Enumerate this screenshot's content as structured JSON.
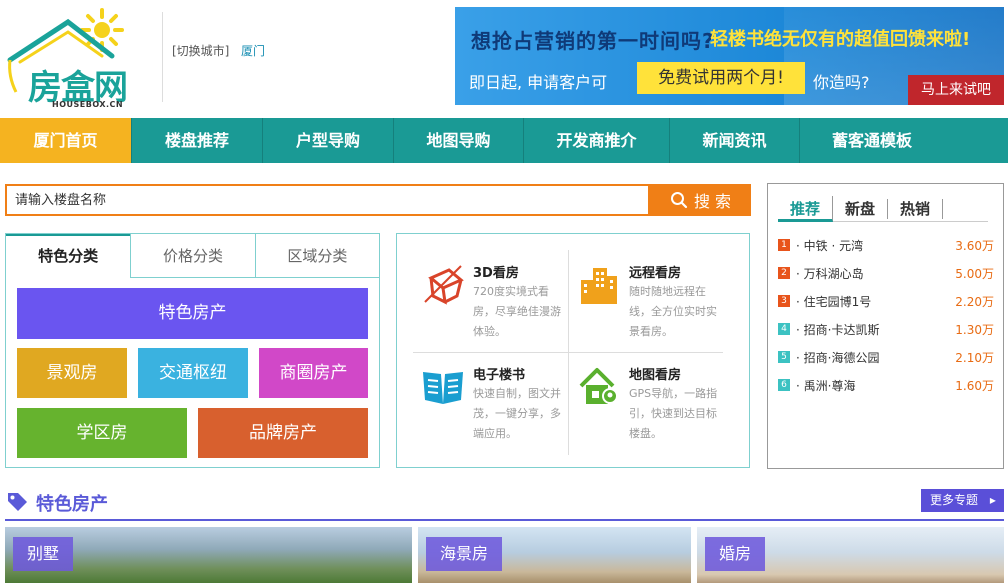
{
  "header": {
    "logo_text": "房盒网",
    "logo_sub": "HOUSEBOX.CN",
    "city_switch": "[切换城市]",
    "city": "厦门"
  },
  "banner": {
    "line1_a": "想抢占营销的第一时间吗?",
    "line1_b": "轻楼书绝无仅有的超值回馈来啦!",
    "line2_a": "即日起, 申请客户可",
    "highlight": "免费试用两个月!",
    "line2_b": "你造吗?",
    "cta": "马上来试吧"
  },
  "nav": {
    "items": [
      "厦门首页",
      "楼盘推荐",
      "户型导购",
      "地图导购",
      "开发商推介",
      "新闻资讯",
      "蓄客通模板"
    ]
  },
  "search": {
    "placeholder": "请输入楼盘名称",
    "button": "搜 索"
  },
  "categories": {
    "tabs": [
      "特色分类",
      "价格分类",
      "区域分类"
    ],
    "tiles": [
      {
        "label": "特色房产",
        "color": "#6a55f0"
      },
      {
        "label": "景观房",
        "color": "#e0a821"
      },
      {
        "label": "交通枢纽",
        "color": "#3ab2e0"
      },
      {
        "label": "商圈房产",
        "color": "#d148c8"
      },
      {
        "label": "学区房",
        "color": "#66b32e"
      },
      {
        "label": "品牌房产",
        "color": "#d8602e"
      }
    ]
  },
  "features": [
    {
      "title": "3D看房",
      "desc": "720度实境式看房，尽享绝佳漫游体验。",
      "icon": "cube-icon"
    },
    {
      "title": "远程看房",
      "desc": "随时随地远程在线，全方位实时实景看房。",
      "icon": "buildings-icon"
    },
    {
      "title": "电子楼书",
      "desc": "快速自制，图文并茂，一键分享，多端应用。",
      "icon": "book-icon"
    },
    {
      "title": "地图看房",
      "desc": "GPS导航，一路指引，快速到达目标楼盘。",
      "icon": "map-house-icon"
    }
  ],
  "ranking": {
    "tabs": [
      "推荐",
      "新盘",
      "热销"
    ],
    "items": [
      {
        "num": "1",
        "name": "· 中铁 · 元湾",
        "price": "3.60万",
        "color": "#e8541b"
      },
      {
        "num": "2",
        "name": "· 万科湖心岛",
        "price": "5.00万",
        "color": "#e8541b"
      },
      {
        "num": "3",
        "name": "· 住宅园博1号",
        "price": "2.20万",
        "color": "#e8541b"
      },
      {
        "num": "4",
        "name": "· 招商·卡达凯斯",
        "price": "1.30万",
        "color": "#3cc2c2"
      },
      {
        "num": "5",
        "name": "· 招商·海德公园",
        "price": "2.10万",
        "color": "#3cc2c2"
      },
      {
        "num": "6",
        "name": "· 禹洲·尊海",
        "price": "1.60万",
        "color": "#3cc2c2"
      }
    ]
  },
  "section": {
    "title": "特色房产",
    "more": "更多专题",
    "photos": [
      "别墅",
      "海景房",
      "婚房"
    ]
  },
  "colors": {
    "teal": "#1a9a95",
    "nav_active": "#f5b320",
    "orange": "#f07f16",
    "purple": "#5a5ad8"
  }
}
